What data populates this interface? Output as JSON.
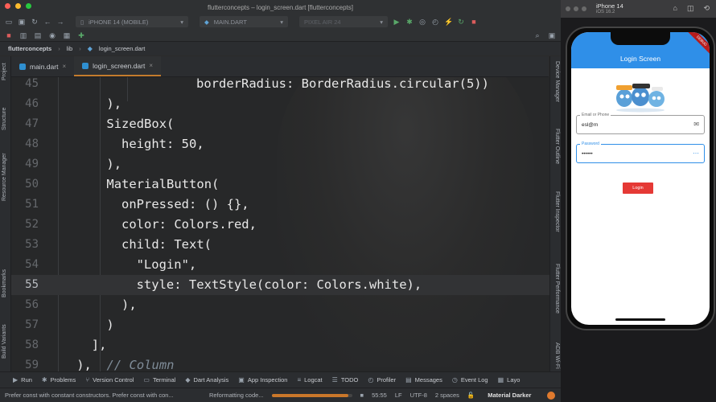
{
  "window": {
    "title": "flutterconcepts – login_screen.dart [flutterconcepts]"
  },
  "toolbar": {
    "device_select": "iPHONE 14 (MOBILE)",
    "run_config": "MAIN.DART",
    "device_select_2": "PIXEL AIR 24"
  },
  "breadcrumb": [
    "flutterconcepts",
    "lib",
    "login_screen.dart"
  ],
  "tabs": [
    {
      "label": "main.dart",
      "active": false
    },
    {
      "label": "login_screen.dart",
      "active": true
    }
  ],
  "left_tools": [
    "Project",
    "Structure",
    "Resource Manager",
    "Bookmarks",
    "Build Variants"
  ],
  "right_tools": [
    "Device Manager",
    "Flutter Outline",
    "Flutter Inspector",
    "Flutter Performance",
    "ADB Wi-Fi"
  ],
  "editor": {
    "current_line": "55",
    "lines": [
      {
        "num": "45",
        "text": "            borderRadius: BorderRadius.circular(5))",
        "indent": 8
      },
      {
        "num": "46",
        "text": "        ),",
        "indent": 0
      },
      {
        "num": "47",
        "text": "        SizedBox(",
        "indent": 0
      },
      {
        "num": "48",
        "text": "          height: 50,",
        "indent": 0
      },
      {
        "num": "49",
        "text": "        ),",
        "indent": 0
      },
      {
        "num": "50",
        "text": "        MaterialButton(",
        "indent": 0
      },
      {
        "num": "51",
        "text": "          onPressed: () {},",
        "indent": 0
      },
      {
        "num": "52",
        "text": "          color: Colors.red,",
        "indent": 0
      },
      {
        "num": "53",
        "text": "          child: Text(",
        "indent": 0
      },
      {
        "num": "54",
        "text": "            \"Login\",",
        "indent": 0
      },
      {
        "num": "55",
        "text": "            style: TextStyle(color: Colors.white),",
        "indent": 0
      },
      {
        "num": "56",
        "text": "          ),",
        "indent": 0
      },
      {
        "num": "57",
        "text": "        )",
        "indent": 0
      },
      {
        "num": "58",
        "text": "      ],",
        "indent": 0
      },
      {
        "num": "59",
        "text": "    ),  // Column",
        "indent": 0
      }
    ]
  },
  "bottom_tools": [
    "Run",
    "Problems",
    "Version Control",
    "Terminal",
    "Dart Analysis",
    "App Inspection",
    "Logcat",
    "TODO",
    "Profiler",
    "Messages",
    "Event Log",
    "Layo"
  ],
  "status": {
    "message": "Prefer const with constant constructors. Prefer const with con...",
    "task": "Reformatting code...",
    "progress": 0.95,
    "position": "55:55",
    "line_sep": "LF",
    "encoding": "UTF-8",
    "indent": "2 spaces",
    "theme": "Material Darker"
  },
  "simulator": {
    "device": "iPhone 14",
    "os": "iOS 16.2",
    "app_title": "Login Screen",
    "debug_banner": "DEBUG",
    "email_label": "Email or Phone",
    "email_value": "esl@m",
    "password_label": "Password",
    "password_value": "••••••",
    "login_label": "Login",
    "colors": {
      "appbar": "#2f8fe8",
      "button": "#e53935"
    }
  }
}
